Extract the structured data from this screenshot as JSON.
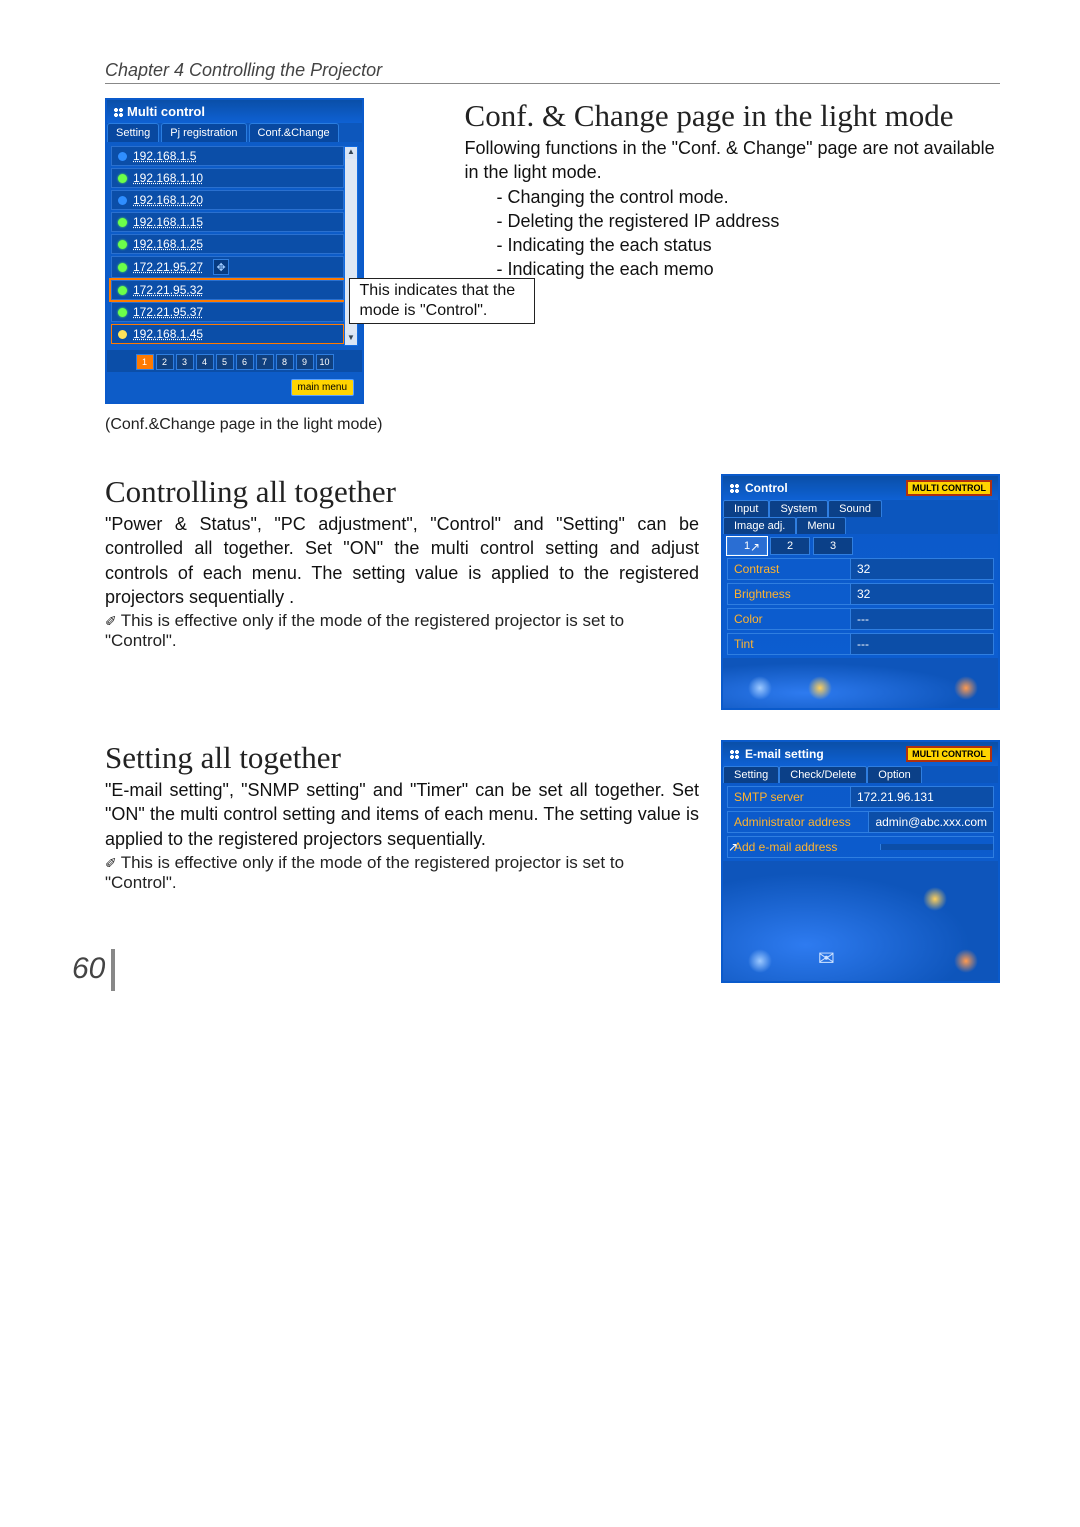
{
  "chapter": "Chapter 4 Controlling the Projector",
  "page_number": "60",
  "section1": {
    "title": "Conf. & Change page in the light mode",
    "body": "Following functions in the \"Conf. & Change\" page are not available in the light mode.",
    "items": [
      "- Changing the control mode.",
      "- Deleting the registered IP address",
      "- Indicating the each status",
      "- Indicating the each memo"
    ]
  },
  "fig1": {
    "window_title": "Multi control",
    "tabs": {
      "t0": "Setting",
      "t1": "Pj registration",
      "t2": "Conf.&Change"
    },
    "ips": [
      {
        "ip": "192.168.1.5",
        "status": "blue"
      },
      {
        "ip": "192.168.1.10",
        "status": "green"
      },
      {
        "ip": "192.168.1.20",
        "status": "blue"
      },
      {
        "ip": "192.168.1.15",
        "status": "green"
      },
      {
        "ip": "192.168.1.25",
        "status": "green"
      },
      {
        "ip": "172.21.95.27",
        "status": "green"
      },
      {
        "ip": "172.21.95.32",
        "status": "green"
      },
      {
        "ip": "172.21.95.37",
        "status": "green"
      },
      {
        "ip": "192.168.1.45",
        "status": "yellow"
      }
    ],
    "pager_count": 10,
    "main_menu": "main menu",
    "annotation": "This indicates that the mode is \"Control\".",
    "caption": "(Conf.&Change page in the light mode)"
  },
  "section2": {
    "title": "Controlling all together",
    "body": "\"Power & Status\", \"PC adjustment\", \"Control\" and \"Setting\" can be controlled all together. Set \"ON\" the multi control setting and adjust controls of each menu. The setting value is applied to the registered projectors sequentially .",
    "note": "This is effective only if the mode of the registered projector is set to \"Control\"."
  },
  "fig2": {
    "title": "Control",
    "badge": "MULTI CONTROL",
    "tabs1": {
      "a": "Input",
      "b": "System",
      "c": "Sound"
    },
    "tabs2": {
      "a": "Image adj.",
      "b": "Menu"
    },
    "tabs3": {
      "a": "1",
      "b": "2",
      "c": "3"
    },
    "rows": [
      {
        "k": "Contrast",
        "v": "32"
      },
      {
        "k": "Brightness",
        "v": "32"
      },
      {
        "k": "Color",
        "v": "---"
      },
      {
        "k": "Tint",
        "v": "---"
      }
    ]
  },
  "section3": {
    "title": "Setting all together",
    "body": "\"E-mail setting\", \"SNMP setting\" and \"Timer\" can be set all together. Set \"ON\" the multi control setting and items of each menu. The setting value is applied to the registered projectors sequentially.",
    "note": "This is effective only if the mode of the registered projector is set to \"Control\"."
  },
  "fig3": {
    "title": "E-mail setting",
    "badge": "MULTI CONTROL",
    "tabs": {
      "a": "Setting",
      "b": "Check/Delete",
      "c": "Option"
    },
    "rows": [
      {
        "k": "SMTP server",
        "v": "172.21.96.131"
      },
      {
        "k": "Administrator address",
        "v": "admin@abc.xxx.com"
      },
      {
        "k": "Add e-mail address",
        "v": ""
      }
    ]
  }
}
